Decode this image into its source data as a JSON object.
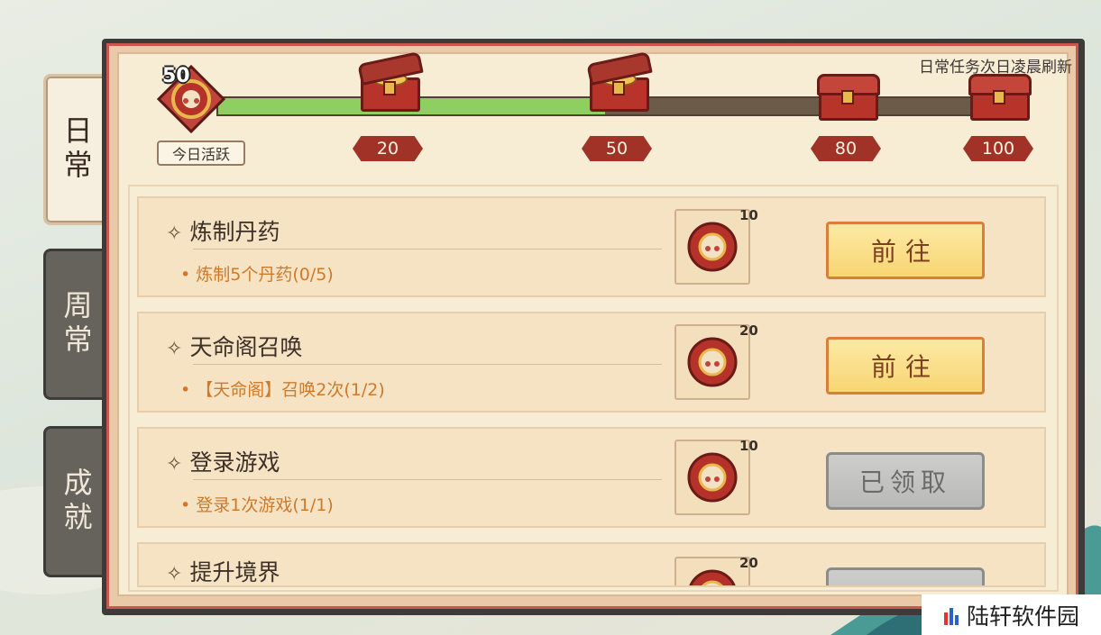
{
  "tabs": [
    {
      "label": "日常",
      "active": true
    },
    {
      "label": "周常",
      "active": false
    },
    {
      "label": "成就",
      "active": false
    }
  ],
  "header": {
    "refresh_note": "日常任务次日凌晨刷新",
    "activity_value": "50",
    "activity_label": "今日活跃",
    "progress_fraction": 0.5,
    "milestones": [
      "20",
      "50",
      "80",
      "100"
    ]
  },
  "tasks": [
    {
      "title": "炼制丹药",
      "desc": "• 炼制5个丹药(0/5)",
      "reward_count": "10",
      "button": "前往",
      "state": "go"
    },
    {
      "title": "天命阁召唤",
      "desc": "• 【天命阁】召唤2次(1/2)",
      "reward_count": "20",
      "button": "前往",
      "state": "go"
    },
    {
      "title": "登录游戏",
      "desc": "• 登录1次游戏(1/1)",
      "reward_count": "10",
      "button": "已领取",
      "state": "claimed"
    },
    {
      "title": "提升境界",
      "desc": "",
      "reward_count": "20",
      "button": "",
      "state": "claimed"
    }
  ],
  "watermark": "陆轩软件园",
  "colors": {
    "accent_red": "#a03228",
    "progress_green": "#8fcf61",
    "go_button": "#f7d672",
    "task_desc": "#cf7a2b"
  }
}
